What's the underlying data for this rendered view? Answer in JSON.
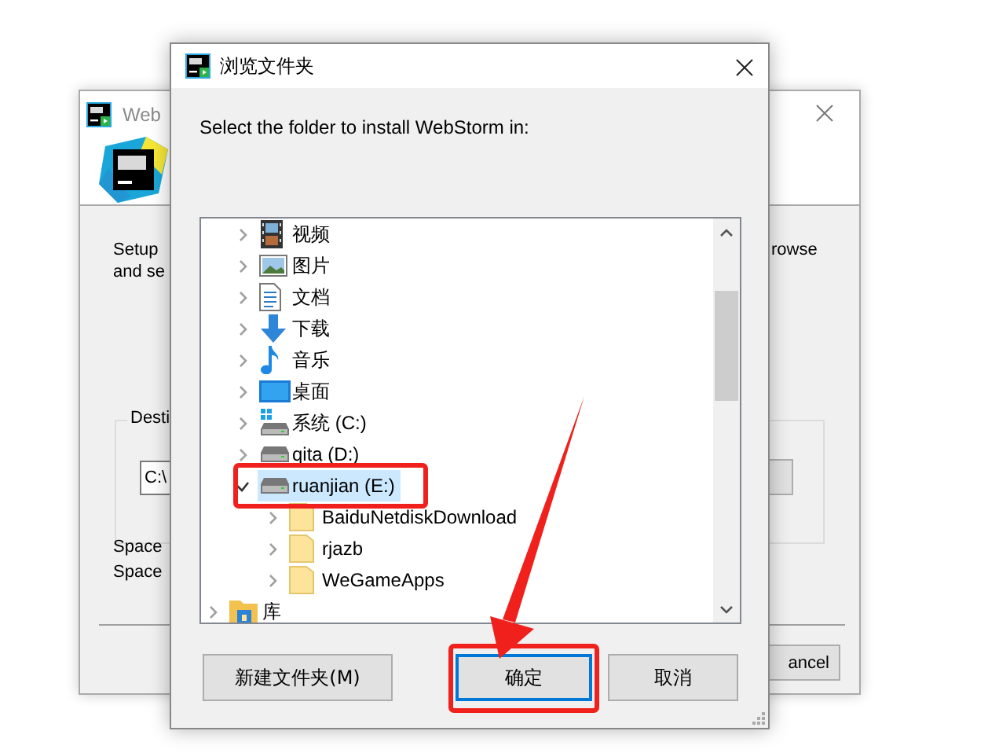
{
  "back_window": {
    "title": "Web",
    "intro_lines": [
      "Setup",
      "and se"
    ],
    "intro_tail": "rowse",
    "group_label": "Desti",
    "path_value": "C:\\",
    "space_lines": [
      "Space",
      "Space"
    ],
    "cancel_button": "ancel"
  },
  "dialog": {
    "title": "浏览文件夹",
    "prompt": "Select the folder to install WebStorm in:",
    "tree": [
      {
        "children": [
          {
            "label": "视频",
            "kind": "video",
            "expanded": false,
            "selected": false
          },
          {
            "label": "图片",
            "kind": "image",
            "expanded": false,
            "selected": false
          },
          {
            "label": "文档",
            "kind": "document",
            "expanded": false,
            "selected": false
          },
          {
            "label": "下载",
            "kind": "download",
            "expanded": false,
            "selected": false
          },
          {
            "label": "音乐",
            "kind": "music",
            "expanded": false,
            "selected": false
          },
          {
            "label": "桌面",
            "kind": "desktop",
            "expanded": false,
            "selected": false
          },
          {
            "label": "系统 (C:)",
            "kind": "system-drive",
            "expanded": false,
            "selected": false
          },
          {
            "label": "qita (D:)",
            "kind": "drive",
            "expanded": false,
            "selected": false
          },
          {
            "label": "ruanjian (E:)",
            "kind": "drive",
            "expanded": true,
            "selected": true,
            "children": [
              {
                "label": "BaiduNetdiskDownload",
                "kind": "folder",
                "expanded": false,
                "selected": false
              },
              {
                "label": "rjazb",
                "kind": "folder",
                "expanded": false,
                "selected": false
              },
              {
                "label": "WeGameApps",
                "kind": "folder",
                "expanded": false,
                "selected": false
              }
            ]
          }
        ]
      },
      {
        "label": "库",
        "kind": "library",
        "expanded": false,
        "selected": false
      }
    ],
    "buttons": [
      {
        "label": "新建文件夹(M)",
        "focused": false
      },
      {
        "label": "确定",
        "focused": true
      },
      {
        "label": "取消",
        "focused": false
      }
    ]
  }
}
